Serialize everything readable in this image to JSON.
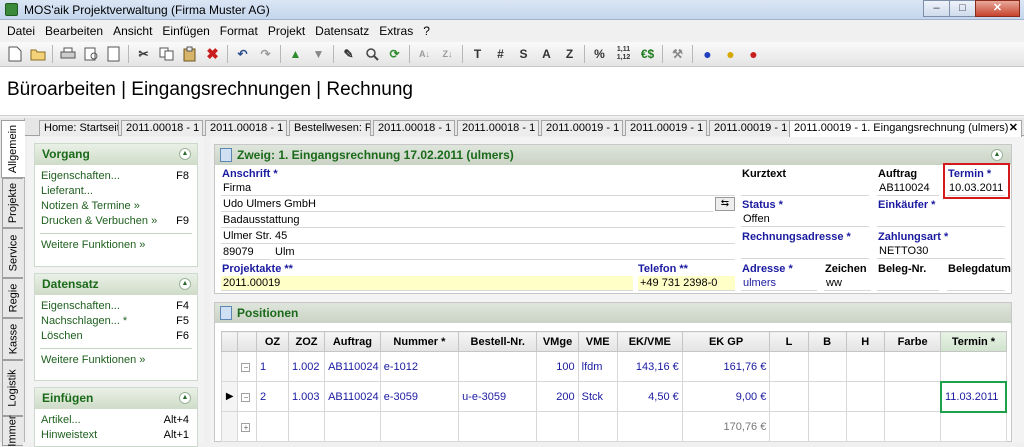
{
  "window": {
    "title": "MOS'aik Projektverwaltung (Firma Muster AG)"
  },
  "menu": [
    "Datei",
    "Bearbeiten",
    "Ansicht",
    "Einfügen",
    "Format",
    "Projekt",
    "Datensatz",
    "Extras",
    "?"
  ],
  "toolbar": {
    "text_buttons": [
      "T",
      "#",
      "S",
      "A",
      "Z",
      "%",
      "1,11 1,12",
      "€$"
    ]
  },
  "page_title": "Büroarbeiten | Eingangsrechnungen | Rechnung",
  "vertical_tabs": [
    "Allgemein",
    "Projekte",
    "Service",
    "Regie",
    "Kasse",
    "Logistik",
    "Immer"
  ],
  "doc_tabs": [
    "Home: Startseite",
    "2011.00018 - 1",
    "2011.00018 - 1",
    "Bestellwesen: P",
    "2011.00018 - 1",
    "2011.00018 - 1",
    "2011.00019 - 1",
    "2011.00019 - 1",
    "2011.00019 - 1",
    "2011.00019 - 1. Eingangsrechnung (ulmers)"
  ],
  "left": {
    "vorgang": {
      "title": "Vorgang",
      "items": [
        {
          "label": "Eigenschaften...",
          "key": "F8"
        },
        {
          "label": "Lieferant...",
          "key": ""
        },
        {
          "label": "Notizen & Termine »",
          "key": ""
        },
        {
          "label": "Drucken & Verbuchen »",
          "key": "F9"
        }
      ],
      "more": "Weitere Funktionen »"
    },
    "datensatz": {
      "title": "Datensatz",
      "items": [
        {
          "label": "Eigenschaften...",
          "key": "F4"
        },
        {
          "label": "Nachschlagen... *",
          "key": "F5"
        },
        {
          "label": "Löschen",
          "key": "F6"
        }
      ],
      "more": "Weitere Funktionen »"
    },
    "einfuegen": {
      "title": "Einfügen",
      "items": [
        {
          "label": "Artikel...",
          "key": "Alt+4"
        },
        {
          "label": "Hinweistext",
          "key": "Alt+1"
        }
      ]
    }
  },
  "zweig": {
    "title": "Zweig: 1. Eingangsrechnung 17.02.2011 (ulmers)",
    "anschrift_label": "Anschrift *",
    "anschrift": [
      "Firma",
      "Udo Ulmers GmbH",
      "Badausstattung",
      "Ulmer Str. 45"
    ],
    "plz": "89079",
    "ort": "Ulm",
    "kurztext_label": "Kurztext",
    "kurztext": "",
    "auftrag_label": "Auftrag",
    "auftrag": "AB110024",
    "termin_label": "Termin *",
    "termin": "10.03.2011",
    "status_label": "Status *",
    "status": "Offen",
    "einkaeufer_label": "Einkäufer *",
    "einkaeufer": "",
    "rechnungsadresse_label": "Rechnungsadresse *",
    "rechnungsadresse": "",
    "zahlungsart_label": "Zahlungsart *",
    "zahlungsart": "NETTO30",
    "projektakte_label": "Projektakte **",
    "projektakte": "2011.00019",
    "telefon_label": "Telefon **",
    "telefon": "+49 731 2398-0",
    "adresse_label": "Adresse *",
    "adresse": "ulmers",
    "zeichen_label": "Zeichen",
    "zeichen": "ww",
    "belegnr_label": "Beleg-Nr.",
    "belegnr": "",
    "belegdatum_label": "Belegdatum",
    "belegdatum": ""
  },
  "positionen": {
    "title": "Positionen",
    "columns": [
      "OZ",
      "ZOZ",
      "Auftrag",
      "Nummer *",
      "Bestell-Nr.",
      "VMge",
      "VME",
      "EK/VME",
      "EK GP",
      "L",
      "B",
      "H",
      "Farbe",
      "Termin *"
    ],
    "rows": [
      {
        "oz": "1",
        "zoz": "1.002",
        "auftrag": "AB110024",
        "nummer": "e-1012",
        "bestell": "",
        "vmge": "100",
        "vme": "lfdm",
        "ekvme": "143,16 €",
        "ekgp": "161,76 €",
        "termin": ""
      },
      {
        "oz": "2",
        "zoz": "1.003",
        "auftrag": "AB110024",
        "nummer": "e-3059",
        "bestell": "u-e-3059",
        "vmge": "200",
        "vme": "Stck",
        "ekvme": "4,50 €",
        "ekgp": "9,00 €",
        "termin": "11.03.2011"
      }
    ],
    "total": "170,76 €"
  }
}
